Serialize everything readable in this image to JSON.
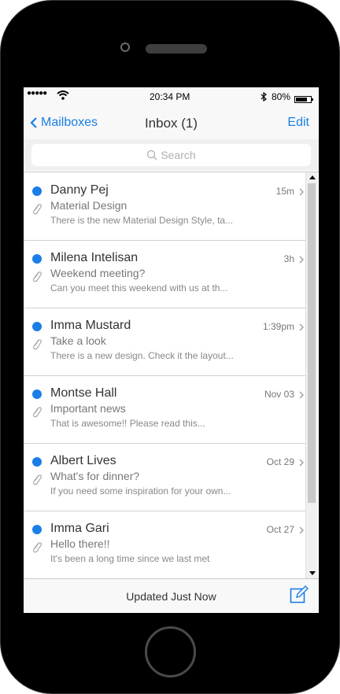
{
  "status_bar": {
    "signal": "●●●●●",
    "time": "20:34 PM",
    "battery": "80%"
  },
  "nav": {
    "back_label": "Mailboxes",
    "title": "Inbox (1)",
    "edit_label": "Edit"
  },
  "search": {
    "placeholder": "Search"
  },
  "messages": [
    {
      "sender": "Danny Pej",
      "subject": "Material Design",
      "preview": "There is the new Material Design Style, ta...",
      "date": "15m",
      "unread": true
    },
    {
      "sender": "Milena Intelisan",
      "subject": "Weekend meeting?",
      "preview": "Can you meet this weekend with us at th...",
      "date": "3h",
      "unread": true
    },
    {
      "sender": "Imma Mustard",
      "subject": "Take a look",
      "preview": "There is a new design. Check it the layout...",
      "date": "1:39pm",
      "unread": true
    },
    {
      "sender": "Montse Hall",
      "subject": "Important news",
      "preview": "That is awesome!! Please read this...",
      "date": "Nov 03",
      "unread": true
    },
    {
      "sender": "Albert Lives",
      "subject": "What's for dinner?",
      "preview": "If you need some inspiration for your own...",
      "date": "Oct 29",
      "unread": true
    },
    {
      "sender": "Imma Gari",
      "subject": "Hello there!!",
      "preview": "It's been a long time since we last met",
      "date": "Oct 27",
      "unread": true
    }
  ],
  "bottom_bar": {
    "status": "Updated Just Now"
  },
  "colors": {
    "accent": "#1a7ee6",
    "unread_dot": "#1a7ee6"
  }
}
